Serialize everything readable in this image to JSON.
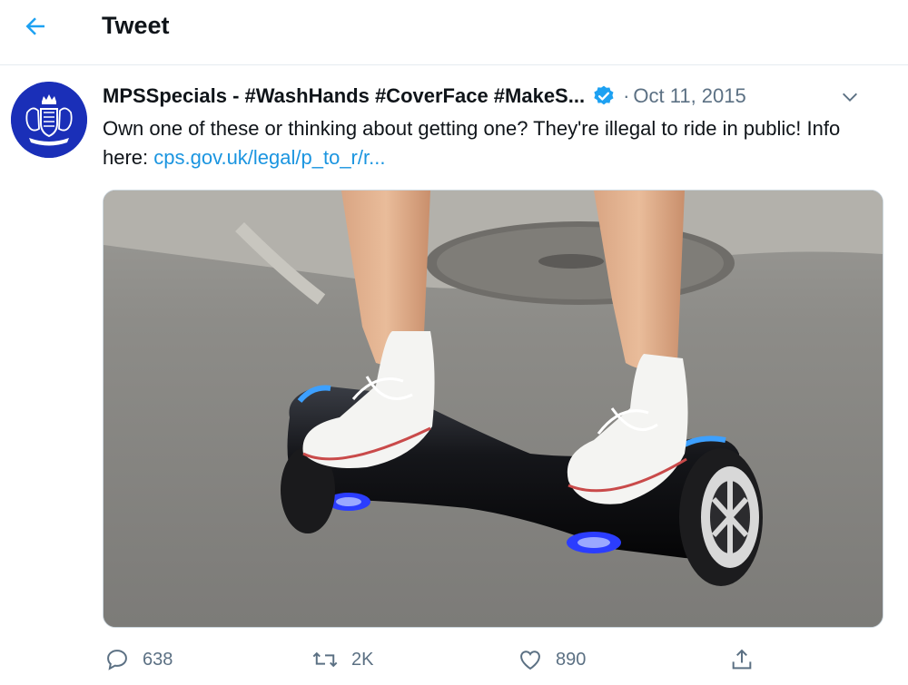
{
  "header": {
    "title": "Tweet",
    "back_icon": "arrow-left-icon",
    "accent": "#1da1f2"
  },
  "tweet": {
    "author": {
      "display_name": "MPSSpecials - #WashHands #CoverFace #MakeS...",
      "avatar_icon": "police-crest-icon",
      "verified": true
    },
    "separator": "·",
    "date": "Oct 11, 2015",
    "text": "Own one of these or thinking about getting one? They're illegal to ride in public! Info here: ",
    "link": "cps.gov.uk/legal/p_to_r/r...",
    "link_color": "#1b95e0",
    "media_description_icon": "hoverboard-photo",
    "actions": {
      "replies": "638",
      "retweets": "2K",
      "likes": "890"
    }
  }
}
